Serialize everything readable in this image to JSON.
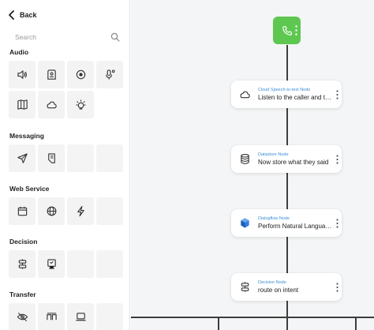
{
  "sidebar": {
    "back_label": "Back",
    "search_placeholder": "Search",
    "sections": [
      {
        "title": "Audio",
        "tiles": [
          "volume-icon",
          "voicemail-box-icon",
          "record-icon",
          "microphone-icon",
          "book-map-icon",
          "cloud-icon",
          "light-bulb-icon"
        ]
      },
      {
        "title": "Messaging",
        "tiles": [
          "send-icon",
          "document-icon"
        ]
      },
      {
        "title": "Web Service",
        "tiles": [
          "calendar-icon",
          "globe-icon",
          "lightning-icon"
        ]
      },
      {
        "title": "Decision",
        "tiles": [
          "decision-icon",
          "monitor-icon"
        ]
      },
      {
        "title": "Transfer",
        "tiles": [
          "eye-off-icon",
          "bracket-icon",
          "laptop-icon"
        ]
      }
    ]
  },
  "flow": {
    "start_icon": "phone-icon",
    "nodes": [
      {
        "type": "Cloud Speech-to-text Node",
        "label": "Listen to the caller and transcribe",
        "icon": "cloud-icon"
      },
      {
        "type": "Datastore Node",
        "label": "Now store what they said",
        "icon": "database-icon"
      },
      {
        "type": "Dialogflow Node",
        "label": "Perform Natural Language Understanding",
        "icon": "dialogflow-icon"
      },
      {
        "type": "Decision Node",
        "label": "route on intent",
        "icon": "decision-icon"
      }
    ]
  },
  "colors": {
    "start": "#5ec750",
    "node_type": "#3a8fd8",
    "dialogflow": "#2f7de1"
  }
}
